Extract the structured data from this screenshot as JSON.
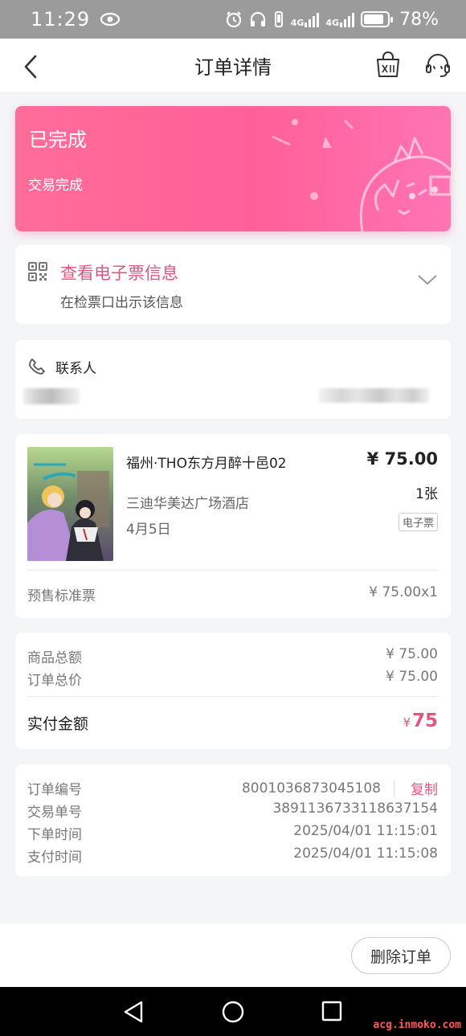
{
  "status_bar": {
    "time": "11:29",
    "network_1": "4G",
    "network_2": "4G",
    "battery": "78%"
  },
  "nav": {
    "title": "订单详情",
    "icons": [
      "back-chevron-icon",
      "shopping-bag-icon",
      "customer-service-icon"
    ]
  },
  "banner": {
    "status": "已完成",
    "sub": "交易完成"
  },
  "eticket": {
    "title": "查看电子票信息",
    "sub": "在检票口出示该信息"
  },
  "contact": {
    "label": "联系人"
  },
  "product": {
    "name": "福州·THO东方月醉十邑02",
    "price": "¥ 75.00",
    "venue": "三迪华美达广场酒店",
    "quantity": "1张",
    "date": "4月5日",
    "tag": "电子票",
    "ticket_type": "预售标准票",
    "unit_price": "¥ 75.00x1"
  },
  "summary": {
    "goods_total_label": "商品总额",
    "goods_total": "¥ 75.00",
    "order_total_label": "订单总价",
    "order_total": "¥ 75.00",
    "paid_label": "实付金额",
    "paid_currency": "¥",
    "paid_amount": "75"
  },
  "order_info": {
    "order_no_label": "订单编号",
    "order_no": "8001036873045108",
    "copy_label": "复制",
    "trade_no_label": "交易单号",
    "trade_no": "3891136733118637154",
    "order_time_label": "下单时间",
    "order_time": "2025/04/01 11:15:01",
    "pay_time_label": "支付时间",
    "pay_time": "2025/04/01 11:15:08"
  },
  "bottom": {
    "delete_label": "删除订单"
  },
  "watermark": "acg.inmoko.com",
  "colors": {
    "accent": "#e0567f",
    "banner": "#ff5f97"
  }
}
